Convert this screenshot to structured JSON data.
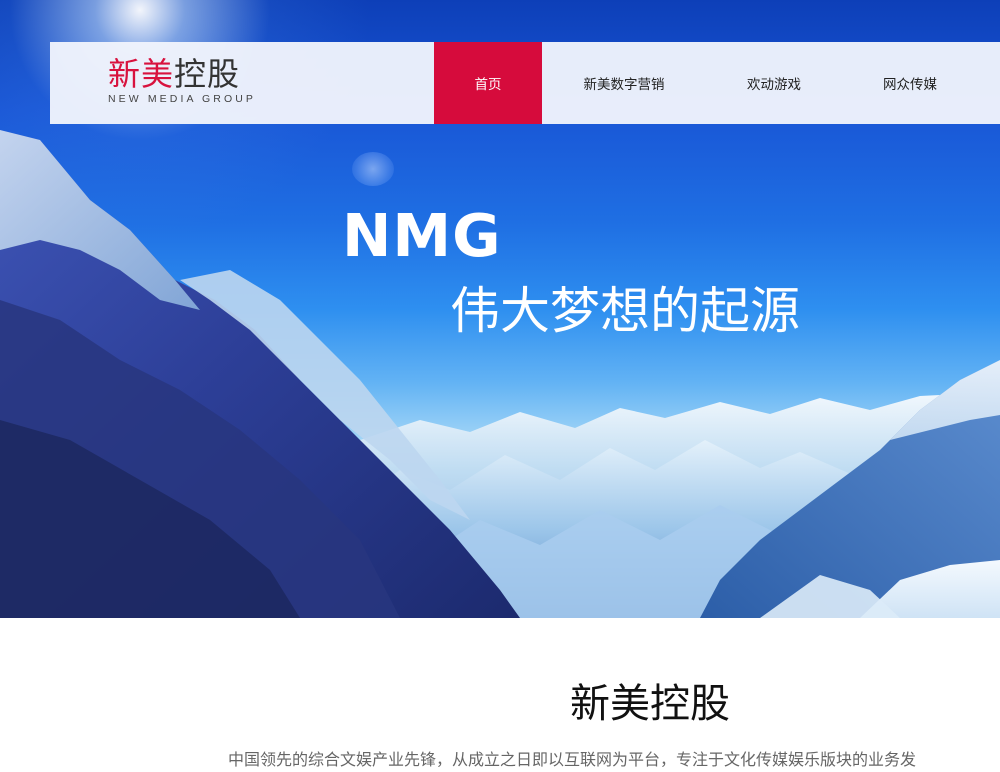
{
  "logo": {
    "cn_part1": "新美",
    "cn_part2": "控股",
    "en": "NEW MEDIA GROUP",
    "color_red": "#d8123e"
  },
  "nav": {
    "items": [
      {
        "label": "首页",
        "active": true
      },
      {
        "label": "新美数字营销",
        "active": false
      },
      {
        "label": "欢动游戏",
        "active": false
      },
      {
        "label": "网众传媒",
        "active": false
      }
    ],
    "active_color": "#d60b3c"
  },
  "hero": {
    "title": "NMG",
    "subtitle": "伟大梦想的起源"
  },
  "about": {
    "title": "新美控股",
    "text": "中国领先的综合文娱产业先锋，从成立之日即以互联网为平台，专注于文化传媒娱乐版块的业务发"
  }
}
